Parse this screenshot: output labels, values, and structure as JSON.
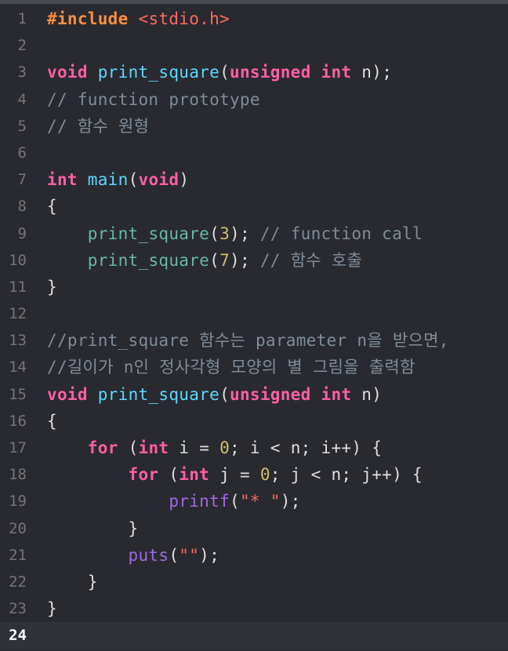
{
  "colors": {
    "background": "#292a30",
    "current_line": "#2f3239",
    "preprocessor": "#fd8f3f",
    "string": "#fc6a5d",
    "keyword": "#fc5fa3",
    "function_declaration": "#5dd8ff",
    "function_call": "#67b7a4",
    "library_function": "#a167e6",
    "number": "#d0bf69",
    "comment": "#7f8c98",
    "plain": "#dfdfe0"
  },
  "editor": {
    "current_line": 24,
    "lines": [
      {
        "number": "1",
        "tokens": [
          {
            "t": "#include ",
            "c": "pre"
          },
          {
            "t": "<stdio.h>",
            "c": "str"
          }
        ]
      },
      {
        "number": "2",
        "tokens": []
      },
      {
        "number": "3",
        "tokens": [
          {
            "t": "void",
            "c": "kw"
          },
          {
            "t": " ",
            "c": "plain"
          },
          {
            "t": "print_square",
            "c": "fn"
          },
          {
            "t": "(",
            "c": "plain"
          },
          {
            "t": "unsigned",
            "c": "kw"
          },
          {
            "t": " ",
            "c": "plain"
          },
          {
            "t": "int",
            "c": "kw"
          },
          {
            "t": " n);",
            "c": "plain"
          }
        ]
      },
      {
        "number": "4",
        "tokens": [
          {
            "t": "// function prototype",
            "c": "com"
          }
        ]
      },
      {
        "number": "5",
        "tokens": [
          {
            "t": "// 함수 원형",
            "c": "com"
          }
        ]
      },
      {
        "number": "6",
        "tokens": []
      },
      {
        "number": "7",
        "tokens": [
          {
            "t": "int",
            "c": "kw"
          },
          {
            "t": " ",
            "c": "plain"
          },
          {
            "t": "main",
            "c": "fn"
          },
          {
            "t": "(",
            "c": "plain"
          },
          {
            "t": "void",
            "c": "kw"
          },
          {
            "t": ")",
            "c": "plain"
          }
        ]
      },
      {
        "number": "8",
        "tokens": [
          {
            "t": "{",
            "c": "plain"
          }
        ]
      },
      {
        "number": "9",
        "tokens": [
          {
            "t": "    ",
            "c": "plain"
          },
          {
            "t": "print_square",
            "c": "fnc"
          },
          {
            "t": "(",
            "c": "plain"
          },
          {
            "t": "3",
            "c": "num"
          },
          {
            "t": "); ",
            "c": "plain"
          },
          {
            "t": "// function call",
            "c": "com"
          }
        ]
      },
      {
        "number": "10",
        "tokens": [
          {
            "t": "    ",
            "c": "plain"
          },
          {
            "t": "print_square",
            "c": "fnc"
          },
          {
            "t": "(",
            "c": "plain"
          },
          {
            "t": "7",
            "c": "num"
          },
          {
            "t": "); ",
            "c": "plain"
          },
          {
            "t": "// 함수 호출",
            "c": "com"
          }
        ]
      },
      {
        "number": "11",
        "tokens": [
          {
            "t": "}",
            "c": "plain"
          }
        ]
      },
      {
        "number": "12",
        "tokens": []
      },
      {
        "number": "13",
        "tokens": [
          {
            "t": "//print_square 함수는 parameter n을 받으면,",
            "c": "com"
          }
        ]
      },
      {
        "number": "14",
        "tokens": [
          {
            "t": "//길이가 n인 정사각형 모양의 별 그림을 출력함",
            "c": "com"
          }
        ]
      },
      {
        "number": "15",
        "tokens": [
          {
            "t": "void",
            "c": "kw"
          },
          {
            "t": " ",
            "c": "plain"
          },
          {
            "t": "print_square",
            "c": "fn"
          },
          {
            "t": "(",
            "c": "plain"
          },
          {
            "t": "unsigned",
            "c": "kw"
          },
          {
            "t": " ",
            "c": "plain"
          },
          {
            "t": "int",
            "c": "kw"
          },
          {
            "t": " n)",
            "c": "plain"
          }
        ]
      },
      {
        "number": "16",
        "tokens": [
          {
            "t": "{",
            "c": "plain"
          }
        ]
      },
      {
        "number": "17",
        "tokens": [
          {
            "t": "    ",
            "c": "plain"
          },
          {
            "t": "for",
            "c": "kw"
          },
          {
            "t": " (",
            "c": "plain"
          },
          {
            "t": "int",
            "c": "kw"
          },
          {
            "t": " i = ",
            "c": "plain"
          },
          {
            "t": "0",
            "c": "num"
          },
          {
            "t": "; i < n; i++) {",
            "c": "plain"
          }
        ]
      },
      {
        "number": "18",
        "tokens": [
          {
            "t": "        ",
            "c": "plain"
          },
          {
            "t": "for",
            "c": "kw"
          },
          {
            "t": " (",
            "c": "plain"
          },
          {
            "t": "int",
            "c": "kw"
          },
          {
            "t": " j = ",
            "c": "plain"
          },
          {
            "t": "0",
            "c": "num"
          },
          {
            "t": "; j < n; j++) {",
            "c": "plain"
          }
        ]
      },
      {
        "number": "19",
        "tokens": [
          {
            "t": "            ",
            "c": "plain"
          },
          {
            "t": "printf",
            "c": "lib"
          },
          {
            "t": "(",
            "c": "plain"
          },
          {
            "t": "\"* \"",
            "c": "str"
          },
          {
            "t": ");",
            "c": "plain"
          }
        ]
      },
      {
        "number": "20",
        "tokens": [
          {
            "t": "        }",
            "c": "plain"
          }
        ]
      },
      {
        "number": "21",
        "tokens": [
          {
            "t": "        ",
            "c": "plain"
          },
          {
            "t": "puts",
            "c": "lib"
          },
          {
            "t": "(",
            "c": "plain"
          },
          {
            "t": "\"\"",
            "c": "str"
          },
          {
            "t": ");",
            "c": "plain"
          }
        ]
      },
      {
        "number": "22",
        "tokens": [
          {
            "t": "    }",
            "c": "plain"
          }
        ]
      },
      {
        "number": "23",
        "tokens": [
          {
            "t": "}",
            "c": "plain"
          }
        ]
      },
      {
        "number": "24",
        "tokens": []
      }
    ]
  }
}
